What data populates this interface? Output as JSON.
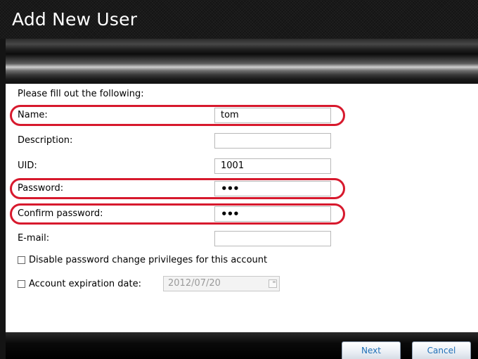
{
  "window": {
    "title": "Add New User"
  },
  "form": {
    "intro": "Please fill out the following:",
    "name": {
      "label": "Name:",
      "value": "tom"
    },
    "description": {
      "label": "Description:",
      "value": ""
    },
    "uid": {
      "label": "UID:",
      "value": "1001"
    },
    "password": {
      "label": "Password:",
      "value": "•••"
    },
    "confirm_password": {
      "label": "Confirm password:",
      "value": "•••"
    },
    "email": {
      "label": "E-mail:",
      "value": ""
    },
    "disable_pw_change": {
      "label": "Disable password change privileges for this account",
      "checked": false
    },
    "expiration": {
      "label": "Account expiration date:",
      "checked": false,
      "value": "2012/07/20",
      "icon": "calendar-icon"
    }
  },
  "buttons": {
    "next": "Next",
    "cancel": "Cancel"
  },
  "colors": {
    "highlight": "#d7192d",
    "button_text": "#1f6fb7",
    "title_bar": "#141414"
  }
}
